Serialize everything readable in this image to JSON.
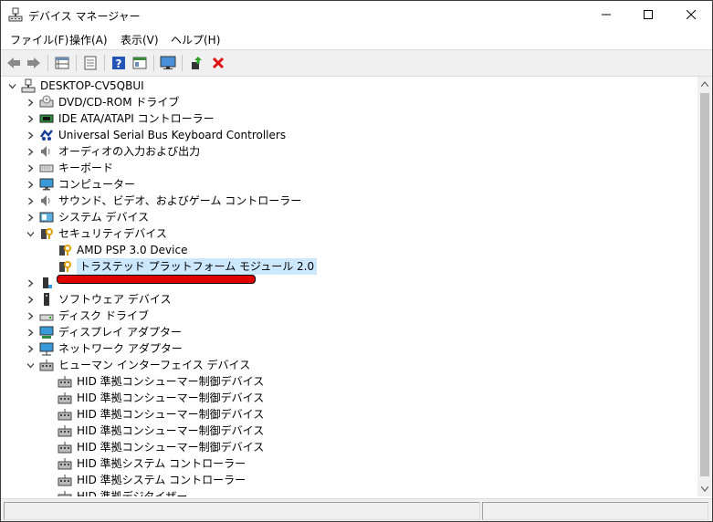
{
  "window": {
    "title": "デバイス マネージャー",
    "accent": "#cce8ff",
    "annotation_color": "#e00000"
  },
  "menu": [
    "ファイル(F)",
    "操作(A)",
    "表示(V)",
    "ヘルプ(H)"
  ],
  "toolbar": {
    "icons": [
      "back-arrow-icon",
      "forward-arrow-icon",
      "properties-grid-icon",
      "sheet-icon",
      "help-icon",
      "panel-icon",
      "monitor-icon",
      "update-driver-icon",
      "uninstall-x-icon"
    ]
  },
  "tree": {
    "root": "DESKTOP-CV5QBUI",
    "items": [
      {
        "label": "DVD/CD-ROM ドライブ",
        "icon": "dvd-drive-icon",
        "expanded": false
      },
      {
        "label": "IDE ATA/ATAPI コントローラー",
        "icon": "ide-controller-icon",
        "expanded": false
      },
      {
        "label": "Universal Serial Bus Keyboard Controllers",
        "icon": "usb-keyboard-controller-icon",
        "expanded": false
      },
      {
        "label": "オーディオの入力および出力",
        "icon": "speaker-icon",
        "expanded": false
      },
      {
        "label": "キーボード",
        "icon": "keyboard-icon",
        "expanded": false
      },
      {
        "label": "コンピューター",
        "icon": "computer-icon",
        "expanded": false
      },
      {
        "label": "サウンド、ビデオ、およびゲーム コントローラー",
        "icon": "speaker-icon",
        "expanded": false
      },
      {
        "label": "システム デバイス",
        "icon": "system-device-icon",
        "expanded": false
      },
      {
        "label": "セキュリティデバイス",
        "icon": "security-device-icon",
        "expanded": true
      },
      {
        "label": "AMD PSP 3.0 Device",
        "icon": "security-device-icon",
        "child": true
      },
      {
        "label": "トラステッド プラットフォーム モジュール 2.0",
        "icon": "security-device-icon",
        "child": true,
        "selected": true
      },
      {
        "label": "",
        "icon": "firmware-icon",
        "expanded": false,
        "obscured": true
      },
      {
        "label": "ソフトウェア デバイス",
        "icon": "software-device-icon",
        "expanded": false
      },
      {
        "label": "ディスク ドライブ",
        "icon": "disk-drive-icon",
        "expanded": false
      },
      {
        "label": "ディスプレイ アダプター",
        "icon": "display-adapter-icon",
        "expanded": false
      },
      {
        "label": "ネットワーク アダプター",
        "icon": "network-adapter-icon",
        "expanded": false
      },
      {
        "label": "ヒューマン インターフェイス デバイス",
        "icon": "hid-icon",
        "expanded": true
      },
      {
        "label": "HID 準拠コンシューマー制御デバイス",
        "icon": "hid-icon",
        "child": true
      },
      {
        "label": "HID 準拠コンシューマー制御デバイス",
        "icon": "hid-icon",
        "child": true
      },
      {
        "label": "HID 準拠コンシューマー制御デバイス",
        "icon": "hid-icon",
        "child": true
      },
      {
        "label": "HID 準拠コンシューマー制御デバイス",
        "icon": "hid-icon",
        "child": true
      },
      {
        "label": "HID 準拠コンシューマー制御デバイス",
        "icon": "hid-icon",
        "child": true
      },
      {
        "label": "HID 準拠システム コントローラー",
        "icon": "hid-icon",
        "child": true
      },
      {
        "label": "HID 準拠システム コントローラー",
        "icon": "hid-icon",
        "child": true
      },
      {
        "label": "HID 準拠デジタイザー",
        "icon": "hid-icon",
        "child": true
      }
    ]
  }
}
